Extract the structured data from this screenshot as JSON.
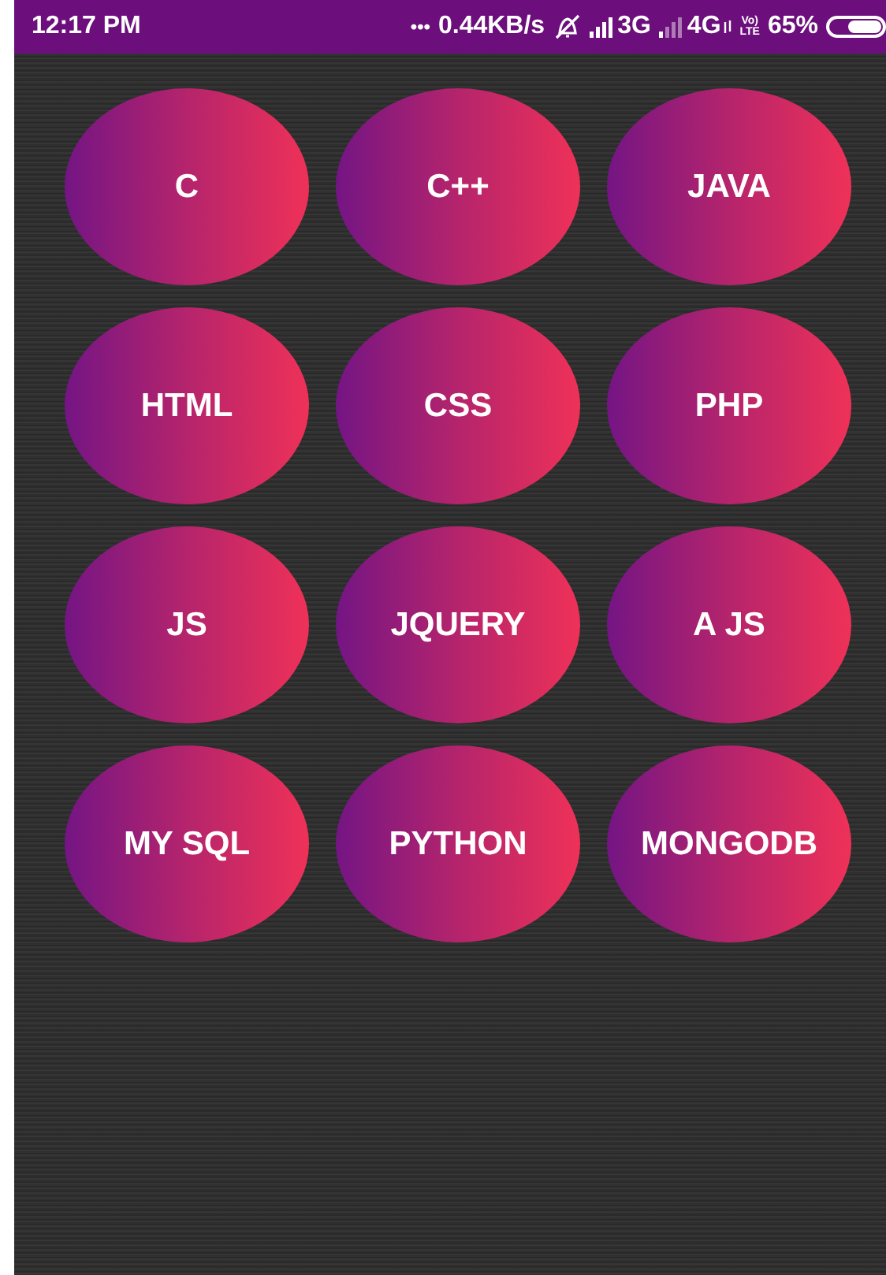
{
  "status_bar": {
    "time": "12:17 PM",
    "dots": "•••",
    "speed": "0.44KB/s",
    "network_3g": "3G",
    "network_4g": "4G",
    "volte_top": "Vo)",
    "volte_bottom": "LTE",
    "battery_text": "65%"
  },
  "buttons": [
    {
      "label": "C"
    },
    {
      "label": "C++"
    },
    {
      "label": "JAVA"
    },
    {
      "label": "HTML"
    },
    {
      "label": "CSS"
    },
    {
      "label": "PHP"
    },
    {
      "label": "JS"
    },
    {
      "label": "JQUERY"
    },
    {
      "label": "A JS"
    },
    {
      "label": "MY SQL"
    },
    {
      "label": "PYTHON"
    },
    {
      "label": "MONGODB"
    }
  ]
}
